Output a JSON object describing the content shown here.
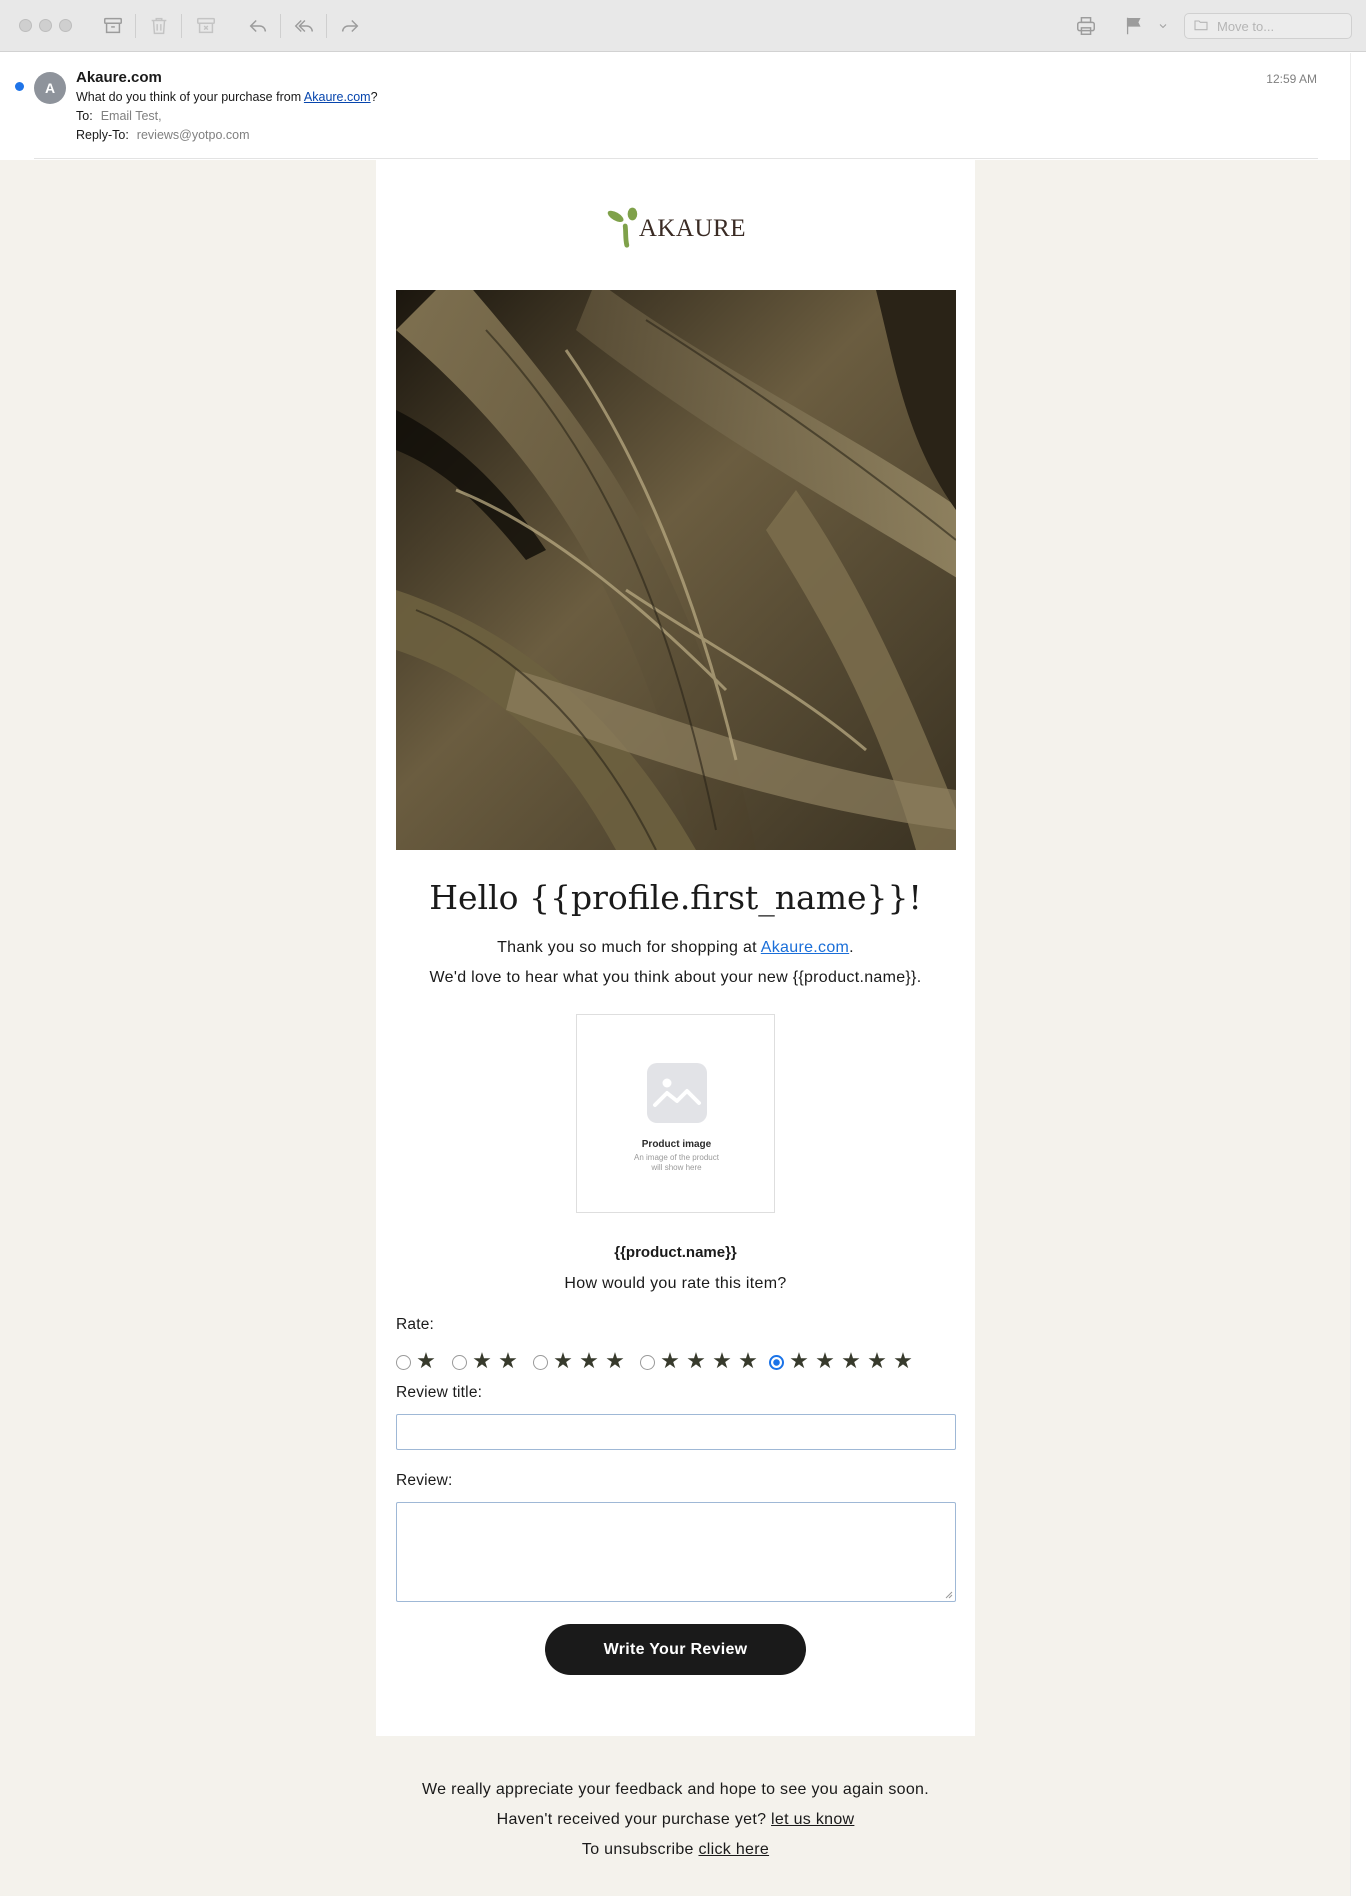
{
  "toolbar": {
    "move_to_placeholder": "Move to..."
  },
  "message": {
    "avatar_initial": "A",
    "sender": "Akaure.com",
    "subject_prefix": "What do you think of your purchase from ",
    "subject_link": "Akaure.com",
    "subject_suffix": "?",
    "to_label": "To:",
    "to_value": "Email Test,",
    "reply_to_label": "Reply-To:",
    "reply_to_value": "reviews@yotpo.com",
    "time": "12:59 AM"
  },
  "email": {
    "logo_text": "AKAURE",
    "greeting": "Hello {{profile.first_name}}!",
    "thanks_prefix": "Thank you so much for shopping at ",
    "thanks_link": "Akaure.com",
    "thanks_suffix": ".",
    "love_line": "We'd love to hear what you think about your new {{product.name}}.",
    "product_image_title": "Product image",
    "product_image_desc_1": "An image of the product",
    "product_image_desc_2": "will show here",
    "product_name": "{{product.name}}",
    "rate_question": "How would you rate this item?",
    "rate_label": "Rate:",
    "rating_options": [
      1,
      2,
      3,
      4,
      5
    ],
    "selected_rating": 5,
    "review_title_label": "Review title:",
    "review_title_value": "",
    "review_label": "Review:",
    "review_value": "",
    "submit_label": "Write Your Review",
    "footer_line1": "We really appreciate your feedback and hope to see you again soon.",
    "footer_line2_prefix": "Haven't received your purchase yet? ",
    "footer_line2_link": "let us know",
    "footer_line3_prefix": "To unsubscribe ",
    "footer_line3_link": "click here"
  },
  "colors": {
    "accent": "#1a73e8",
    "link": "#1a6ed8",
    "page_bg": "#f4f2ec",
    "button": "#1a1a1a",
    "star": "#373a2c",
    "logo_leaf": "#7fa14a"
  },
  "icons": [
    "archive-icon",
    "trash-icon",
    "junk-icon",
    "reply-icon",
    "reply-all-icon",
    "forward-icon",
    "print-icon",
    "flag-icon",
    "chevron-down-icon",
    "folder-icon"
  ]
}
